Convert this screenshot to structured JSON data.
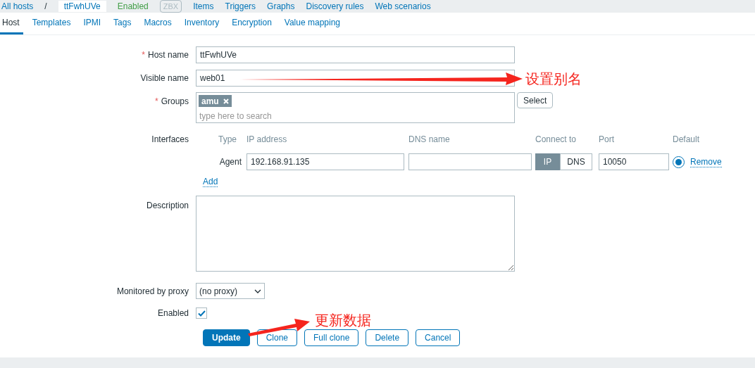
{
  "breadcrumbs": [
    {
      "label": "All hosts",
      "kind": "link"
    },
    {
      "label": "/",
      "kind": "separator"
    },
    {
      "label": "ttFwhUVe",
      "kind": "current"
    },
    {
      "label": "Enabled",
      "kind": "status"
    },
    {
      "label": "ZBX",
      "kind": "badge"
    },
    {
      "label": "Items",
      "kind": "link"
    },
    {
      "label": "Triggers",
      "kind": "link"
    },
    {
      "label": "Graphs",
      "kind": "link"
    },
    {
      "label": "Discovery rules",
      "kind": "link"
    },
    {
      "label": "Web scenarios",
      "kind": "link"
    }
  ],
  "tabs": [
    {
      "label": "Host",
      "selected": true
    },
    {
      "label": "Templates",
      "selected": false
    },
    {
      "label": "IPMI",
      "selected": false
    },
    {
      "label": "Tags",
      "selected": false
    },
    {
      "label": "Macros",
      "selected": false
    },
    {
      "label": "Inventory",
      "selected": false
    },
    {
      "label": "Encryption",
      "selected": false
    },
    {
      "label": "Value mapping",
      "selected": false
    }
  ],
  "form": {
    "host_name": {
      "label": "Host name",
      "required_mark": "*",
      "value": "ttFwhUVe"
    },
    "visible_name": {
      "label": "Visible name",
      "value": "web01"
    },
    "groups": {
      "label": "Groups",
      "required_mark": "*",
      "tags": [
        "amu"
      ],
      "placeholder": "type here to search",
      "select_button": "Select"
    },
    "interfaces": {
      "label": "Interfaces",
      "columns": [
        "Type",
        "IP address",
        "DNS name",
        "Connect to",
        "Port",
        "Default"
      ],
      "rows": [
        {
          "type": "Agent",
          "ip": "192.168.91.135",
          "connect": [
            {
              "label": "IP",
              "selected": true
            },
            {
              "label": "DNS",
              "selected": false
            }
          ],
          "port": "10050",
          "default": true,
          "remove": "Remove"
        }
      ],
      "add": "Add"
    },
    "description": {
      "label": "Description"
    },
    "proxy": {
      "label": "Monitored by proxy",
      "value": "(no proxy)"
    },
    "enabled": {
      "label": "Enabled",
      "checked": true
    },
    "buttons": [
      {
        "label": "Update",
        "kind": "primary"
      },
      {
        "label": "Clone",
        "kind": "secondary"
      },
      {
        "label": "Full clone",
        "kind": "secondary"
      },
      {
        "label": "Delete",
        "kind": "secondary"
      },
      {
        "label": "Cancel",
        "kind": "secondary"
      }
    ]
  },
  "annotations": [
    {
      "text": "设置别名"
    },
    {
      "text": "更新数据"
    }
  ]
}
